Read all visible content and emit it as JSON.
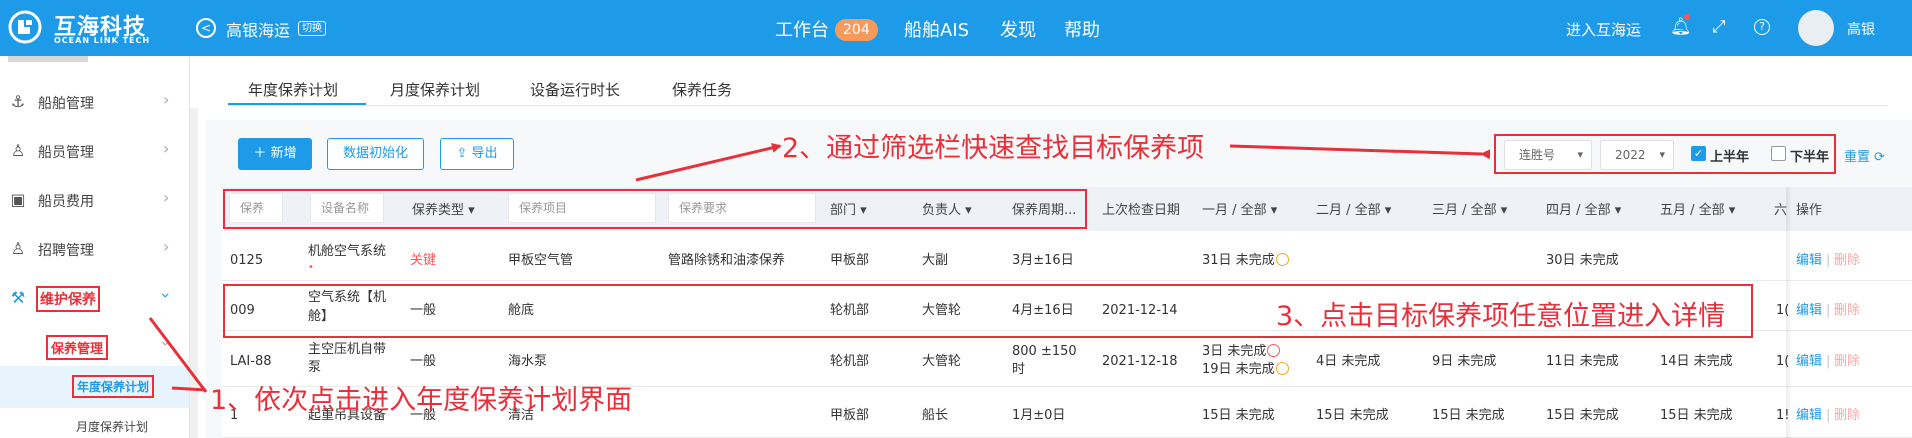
{
  "header": {
    "brand": "互海科技",
    "brand_sub": "OCEAN LINK TECH",
    "company": "高银海运",
    "switch_label": "切换",
    "nav": [
      {
        "label": "工作台",
        "badge": "204"
      },
      {
        "label": "船舶AIS"
      },
      {
        "label": "发现"
      },
      {
        "label": "帮助"
      }
    ],
    "enter_link": "进入互海运",
    "user": "高银"
  },
  "sidebar": {
    "items": [
      {
        "label": "船舶管理",
        "icon": "anchor-icon"
      },
      {
        "label": "船员管理",
        "icon": "user-icon"
      },
      {
        "label": "船员费用",
        "icon": "wallet-icon"
      },
      {
        "label": "招聘管理",
        "icon": "user-icon"
      },
      {
        "label": "维护保养",
        "icon": "wrench-icon"
      }
    ],
    "sub_item": "保养管理",
    "sub_sub_items": [
      "年度保养计划",
      "月度保养计划"
    ]
  },
  "tabs": [
    "年度保养计划",
    "月度保养计划",
    "设备运行时长",
    "保养任务"
  ],
  "toolbar": {
    "add": "新增",
    "init": "数据初始化",
    "export": "导出"
  },
  "filters": {
    "ship": "连胜号",
    "year": "2022",
    "first_half": "上半年",
    "second_half": "下半年",
    "reset": "重置"
  },
  "table": {
    "filter_placeholders": {
      "code": "保养",
      "equipment": "设备名称",
      "item": "保养项目",
      "req": "保养要求"
    },
    "headers": {
      "type": "保养类型",
      "dept": "部门",
      "owner": "负责人",
      "cycle": "保养周期...",
      "last": "上次检查日期",
      "m1": "一月 / 全部",
      "m2": "二月 / 全部",
      "m3": "三月 / 全部",
      "m4": "四月 / 全部",
      "m5": "五月 / 全部",
      "m6": "六",
      "ops": "操作"
    },
    "rows": [
      {
        "code": "0125",
        "equip1": "机舱空气系统",
        "equip2": "",
        "type": "关键",
        "item": "甲板空气管",
        "req": "管路除锈和油漆保养",
        "dept": "甲板部",
        "owner": "大副",
        "cycle1": "3月±16日",
        "cycle2": "",
        "last": "",
        "m1a": "31日 未完成",
        "m1b": "",
        "m2": "",
        "m3": "",
        "m4": "30日 未完成",
        "m5": "",
        "m6": "",
        "edit": "编辑",
        "del": "删除"
      },
      {
        "code": "009",
        "equip1": "空气系统【机",
        "equip2": "舱】",
        "type": "一般",
        "item": "舱底",
        "req": "",
        "dept": "轮机部",
        "owner": "大管轮",
        "cycle1": "4月±16日",
        "cycle2": "",
        "last": "2021-12-14",
        "m1a": "",
        "m1b": "",
        "m2": "",
        "m3": "",
        "m4": "",
        "m5": "",
        "m6": "1(",
        "edit": "编辑",
        "del": "删除"
      },
      {
        "code": "LAI-88",
        "equip1": "主空压机自带",
        "equip2": "泵",
        "type": "一般",
        "item": "海水泵",
        "req": "",
        "dept": "轮机部",
        "owner": "大管轮",
        "cycle1": "800 ±150",
        "cycle2": "时",
        "last": "2021-12-18",
        "m1a": "3日 未完成",
        "m1b": "19日 未完成",
        "m2": "4日 未完成",
        "m3": "9日 未完成",
        "m4": "11日 未完成",
        "m5": "14日 未完成",
        "m6": "1(",
        "edit": "编辑",
        "del": "删除"
      },
      {
        "code": "1",
        "equip1": "起重吊具设备",
        "equip2": "",
        "type": "一般",
        "item": "清洁",
        "req": "",
        "dept": "甲板部",
        "owner": "船长",
        "cycle1": "1月±0日",
        "cycle2": "",
        "last": "",
        "m1a": "15日 未完成",
        "m1b": "",
        "m2": "15日 未完成",
        "m3": "15日 未完成",
        "m4": "15日 未完成",
        "m5": "15日 未完成",
        "m6": "1!",
        "edit": "编辑",
        "del": "删除"
      }
    ]
  },
  "annotations": {
    "a1": "1、依次点击进入年度保养计划界面",
    "a2": "2、通过筛选栏快速查找目标保养项",
    "a3": "3、点击目标保养项任意位置进入详情"
  },
  "colors": {
    "header_bg": "#1e9be8",
    "accent": "#1e9be8",
    "annotation": "#e8303a",
    "badge": "#f59a5b"
  }
}
